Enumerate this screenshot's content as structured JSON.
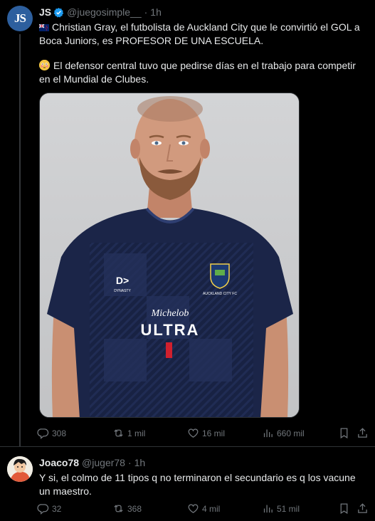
{
  "tweet": {
    "author_name": "JS",
    "author_avatar_text": "JS",
    "handle": "@juegosimple__",
    "separator": "·",
    "time": "1h",
    "line1": "Christian Gray, el futbolista de Auckland City que le convirtió el GOL a Boca Juniors, es PROFESOR DE UNA ESCUELA.",
    "line2": "El defensor central tuvo que pedirse días en el trabajo para competir en el Mundial de Clubes.",
    "flag_icon": "new-zealand-flag-icon",
    "emoji_icon": "flushed-face-emoji",
    "media": {
      "sponsor_top": "Michelob",
      "sponsor_main": "ULTRA",
      "kit_brand": "DYNASTY",
      "crest_text": "AUCKLAND CITY FC"
    },
    "stats": {
      "replies": "308",
      "reposts": "1 mil",
      "likes": "16 mil",
      "views": "660 mil"
    }
  },
  "reply": {
    "author_name": "Joaco78",
    "handle": "@juger78",
    "separator": "·",
    "time": "1h",
    "text": "Y si, el colmo de 11 tipos q no terminaron el secundario es q los vacune un maestro.",
    "stats": {
      "replies": "32",
      "reposts": "368",
      "likes": "4 mil",
      "views": "51 mil"
    }
  },
  "colors": {
    "background": "#000000",
    "text": "#e7e9ea",
    "muted": "#71767b",
    "verified": "#1d9bf0",
    "border": "#2f3336"
  }
}
